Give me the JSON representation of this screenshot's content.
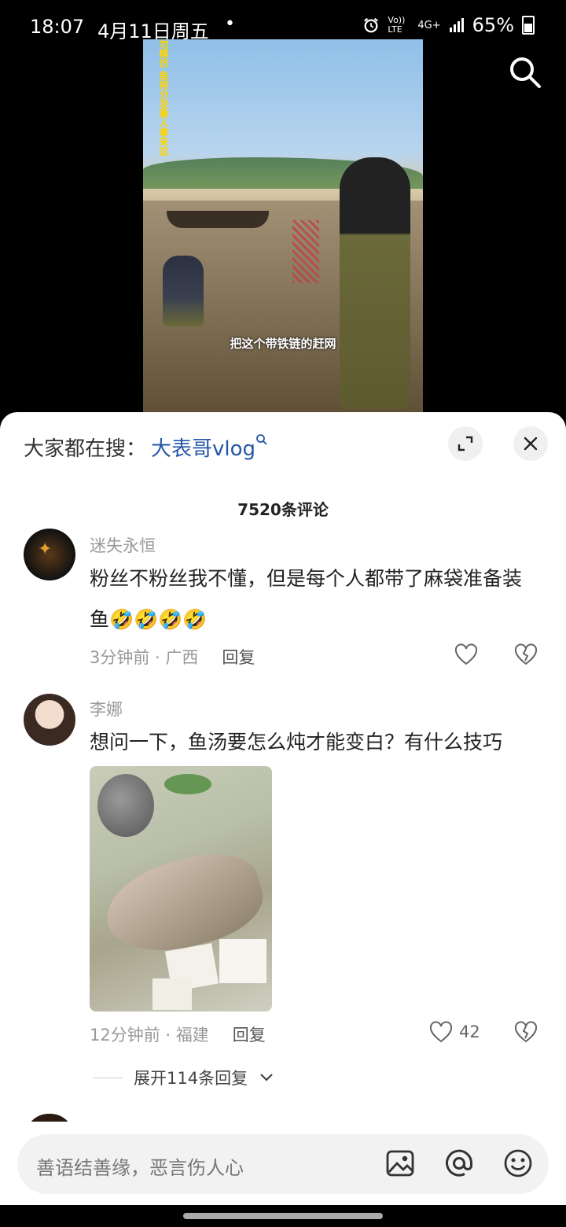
{
  "status_bar": {
    "time": "18:07",
    "date": "4月11日周五",
    "dot": "•",
    "net1": "Vo)) LTE",
    "net2": "4G+",
    "battery": "65%"
  },
  "video": {
    "vertical_caption": "勿模仿 鱼将分发看人拿来这",
    "subtitle": "把这个带铁链的赶网",
    "search_icon": "search-icon"
  },
  "comments_panel": {
    "search_prefix": "大家都在搜：",
    "search_keyword": "大表哥vlog",
    "comment_count": "7520条评论",
    "comments": [
      {
        "username": "迷失永恒",
        "text": "粉丝不粉丝我不懂，但是每个人都带了麻袋准备装鱼🤣🤣🤣🤣",
        "time_location": "3分钟前 · 广西",
        "reply_label": "回复",
        "likes": ""
      },
      {
        "username": "李娜",
        "text": "想问一下，鱼汤要怎么炖才能变白？有什么技巧",
        "time_location": "12分钟前 · 福建",
        "reply_label": "回复",
        "likes": "42",
        "expand_label": "展开114条回复"
      }
    ]
  },
  "input_bar": {
    "placeholder": "善语结善缘，恶言伤人心",
    "icons": [
      "image-icon",
      "at-icon",
      "emoji-icon"
    ]
  },
  "colors": {
    "keyword": "#2456a8",
    "muted": "#999999",
    "panel_bg": "#ffffff"
  }
}
